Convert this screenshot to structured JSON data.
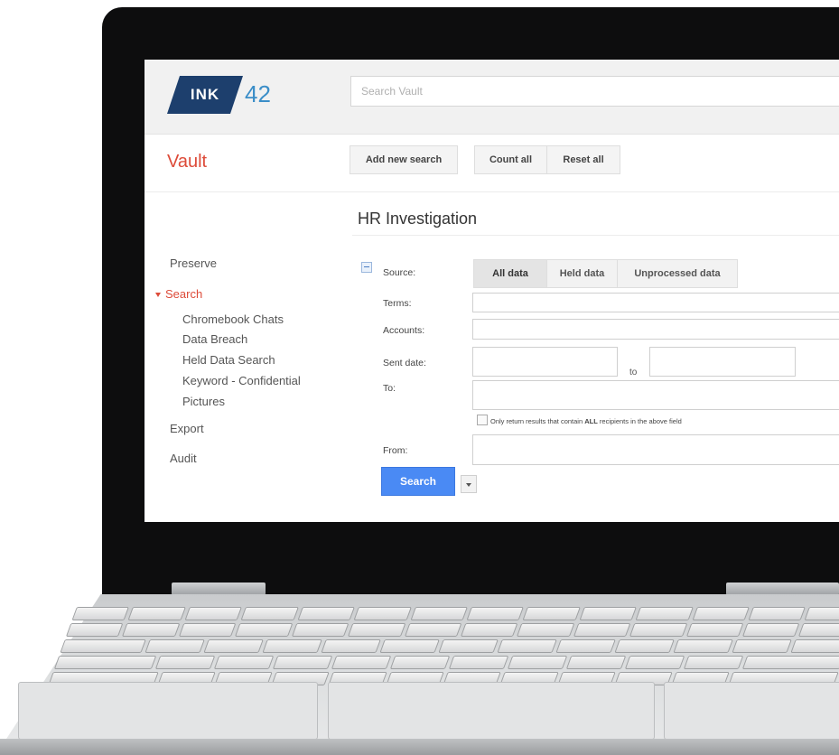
{
  "header": {
    "logo_ink": "INK",
    "logo_num": "42",
    "search_placeholder": "Search Vault"
  },
  "app_title": "Vault",
  "toolbar": {
    "add_new_search": "Add new search",
    "count_all": "Count all",
    "reset_all": "Reset all"
  },
  "sidebar": {
    "preserve": "Preserve",
    "search": "Search",
    "search_items": [
      "Chromebook Chats",
      "Data Breach",
      "Held Data Search",
      "Keyword - Confidential",
      "Pictures"
    ],
    "export": "Export",
    "audit": "Audit"
  },
  "main": {
    "title": "HR Investigation",
    "source_label": "Source:",
    "source_options": [
      "All data",
      "Held data",
      "Unprocessed data"
    ],
    "selected_source": "All data",
    "terms_label": "Terms:",
    "accounts_label": "Accounts:",
    "sent_date_label": "Sent date:",
    "to_word": "to",
    "to_label": "To:",
    "only_return_prefix": "Only return results that contain ",
    "only_return_bold": "ALL",
    "only_return_suffix": " recipients in the above field",
    "from_label": "From:",
    "search_button": "Search"
  },
  "colors": {
    "accent_red": "#dd4b39",
    "logo_navy": "#1d3f6d",
    "logo_blue": "#3b8ec8",
    "primary_button": "#4a8af4"
  }
}
